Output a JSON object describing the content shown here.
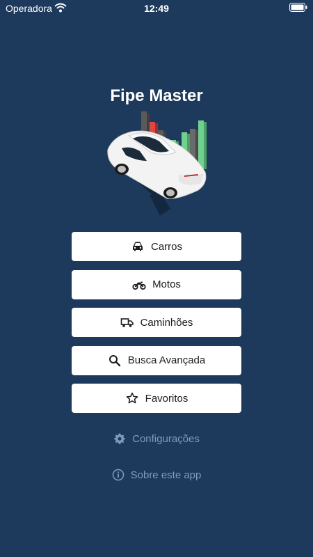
{
  "status_bar": {
    "carrier": "Operadora",
    "time": "12:49",
    "wifi_icon": "wifi-icon",
    "battery_icon": "battery-icon"
  },
  "app": {
    "title": "Fipe Master",
    "hero_image": "car-with-price-chart-illustration"
  },
  "menu": {
    "items": [
      {
        "label": "Carros",
        "icon": "car-icon"
      },
      {
        "label": "Motos",
        "icon": "motorcycle-icon"
      },
      {
        "label": "Caminhões",
        "icon": "truck-icon"
      },
      {
        "label": "Busca Avançada",
        "icon": "search-icon"
      },
      {
        "label": "Favoritos",
        "icon": "star-icon"
      }
    ]
  },
  "links": {
    "settings": {
      "label": "Configurações",
      "icon": "gear-icon"
    },
    "about": {
      "label": "Sobre este app",
      "icon": "info-icon"
    }
  },
  "colors": {
    "background": "#1d3a5c",
    "button_bg": "#ffffff",
    "button_text": "#1b1b1b",
    "link_text": "#7d9cbf",
    "chart_green": "#6fd08f",
    "chart_red": "#e04545",
    "chart_gray": "#6a6a6a"
  }
}
